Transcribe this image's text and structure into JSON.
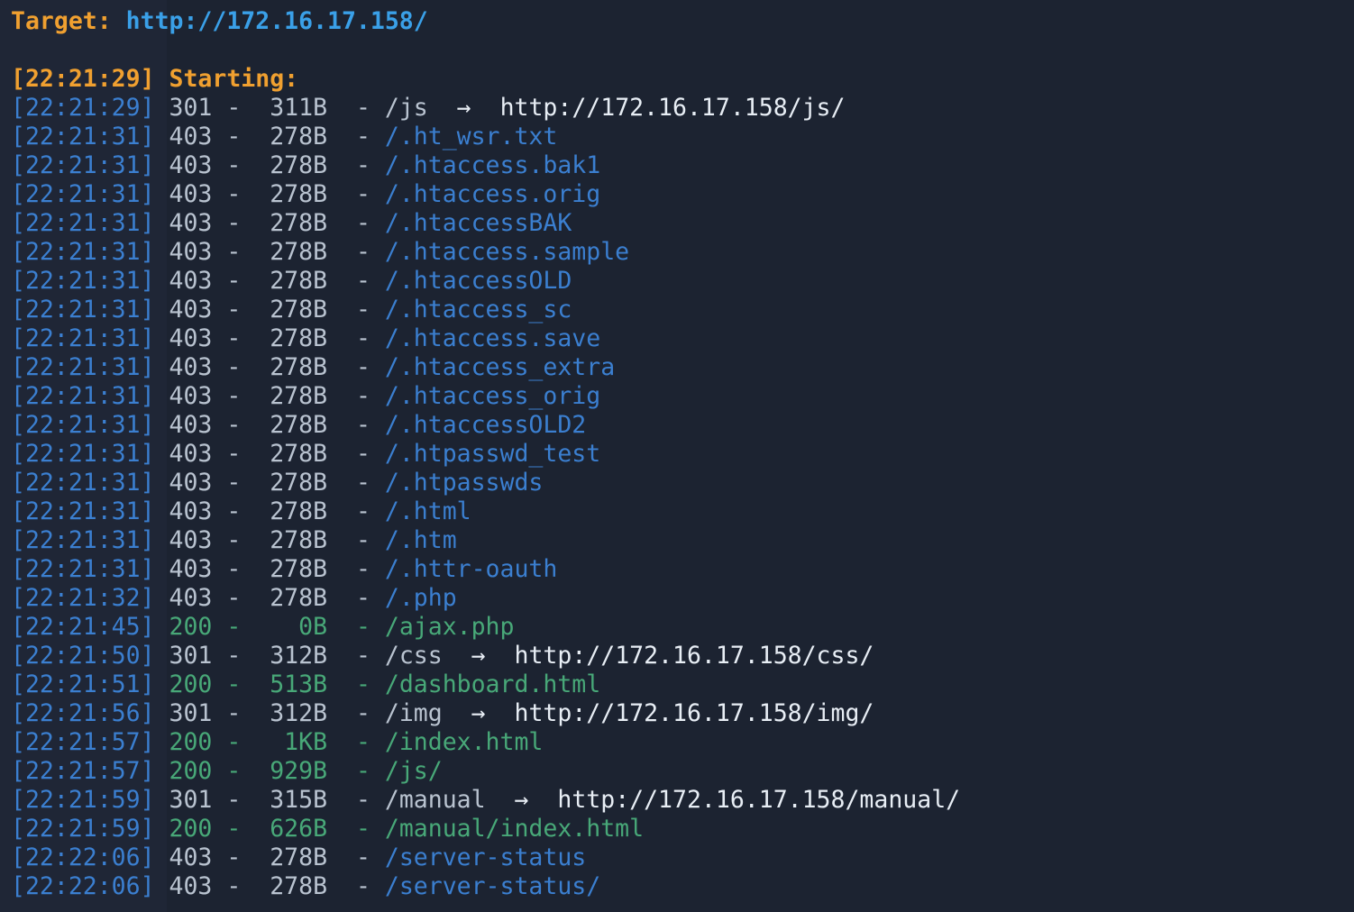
{
  "header": {
    "target_label": "Target:",
    "target_url": "http://172.16.17.158/"
  },
  "start": {
    "timestamp": "[22:21:29]",
    "label": "Starting:"
  },
  "rows": [
    {
      "ts": "[22:21:29]",
      "status": "301",
      "size": "311B",
      "path": "/js",
      "redirect": "http://172.16.17.158/js/"
    },
    {
      "ts": "[22:21:31]",
      "status": "403",
      "size": "278B",
      "path": "/.ht_wsr.txt",
      "redirect": ""
    },
    {
      "ts": "[22:21:31]",
      "status": "403",
      "size": "278B",
      "path": "/.htaccess.bak1",
      "redirect": ""
    },
    {
      "ts": "[22:21:31]",
      "status": "403",
      "size": "278B",
      "path": "/.htaccess.orig",
      "redirect": ""
    },
    {
      "ts": "[22:21:31]",
      "status": "403",
      "size": "278B",
      "path": "/.htaccessBAK",
      "redirect": ""
    },
    {
      "ts": "[22:21:31]",
      "status": "403",
      "size": "278B",
      "path": "/.htaccess.sample",
      "redirect": ""
    },
    {
      "ts": "[22:21:31]",
      "status": "403",
      "size": "278B",
      "path": "/.htaccessOLD",
      "redirect": ""
    },
    {
      "ts": "[22:21:31]",
      "status": "403",
      "size": "278B",
      "path": "/.htaccess_sc",
      "redirect": ""
    },
    {
      "ts": "[22:21:31]",
      "status": "403",
      "size": "278B",
      "path": "/.htaccess.save",
      "redirect": ""
    },
    {
      "ts": "[22:21:31]",
      "status": "403",
      "size": "278B",
      "path": "/.htaccess_extra",
      "redirect": ""
    },
    {
      "ts": "[22:21:31]",
      "status": "403",
      "size": "278B",
      "path": "/.htaccess_orig",
      "redirect": ""
    },
    {
      "ts": "[22:21:31]",
      "status": "403",
      "size": "278B",
      "path": "/.htaccessOLD2",
      "redirect": ""
    },
    {
      "ts": "[22:21:31]",
      "status": "403",
      "size": "278B",
      "path": "/.htpasswd_test",
      "redirect": ""
    },
    {
      "ts": "[22:21:31]",
      "status": "403",
      "size": "278B",
      "path": "/.htpasswds",
      "redirect": ""
    },
    {
      "ts": "[22:21:31]",
      "status": "403",
      "size": "278B",
      "path": "/.html",
      "redirect": ""
    },
    {
      "ts": "[22:21:31]",
      "status": "403",
      "size": "278B",
      "path": "/.htm",
      "redirect": ""
    },
    {
      "ts": "[22:21:31]",
      "status": "403",
      "size": "278B",
      "path": "/.httr-oauth",
      "redirect": ""
    },
    {
      "ts": "[22:21:32]",
      "status": "403",
      "size": "278B",
      "path": "/.php",
      "redirect": ""
    },
    {
      "ts": "[22:21:45]",
      "status": "200",
      "size": "0B",
      "path": "/ajax.php",
      "redirect": ""
    },
    {
      "ts": "[22:21:50]",
      "status": "301",
      "size": "312B",
      "path": "/css",
      "redirect": "http://172.16.17.158/css/"
    },
    {
      "ts": "[22:21:51]",
      "status": "200",
      "size": "513B",
      "path": "/dashboard.html",
      "redirect": ""
    },
    {
      "ts": "[22:21:56]",
      "status": "301",
      "size": "312B",
      "path": "/img",
      "redirect": "http://172.16.17.158/img/"
    },
    {
      "ts": "[22:21:57]",
      "status": "200",
      "size": "1KB",
      "path": "/index.html",
      "redirect": ""
    },
    {
      "ts": "[22:21:57]",
      "status": "200",
      "size": "929B",
      "path": "/js/",
      "redirect": ""
    },
    {
      "ts": "[22:21:59]",
      "status": "301",
      "size": "315B",
      "path": "/manual",
      "redirect": "http://172.16.17.158/manual/"
    },
    {
      "ts": "[22:21:59]",
      "status": "200",
      "size": "626B",
      "path": "/manual/index.html",
      "redirect": ""
    },
    {
      "ts": "[22:22:06]",
      "status": "403",
      "size": "278B",
      "path": "/server-status",
      "redirect": ""
    },
    {
      "ts": "[22:22:06]",
      "status": "403",
      "size": "278B",
      "path": "/server-status/",
      "redirect": ""
    }
  ],
  "separator": " - ",
  "arrow": "→",
  "colors": {
    "background": "#1c2331",
    "accent_orange": "#f0a030",
    "url_blue": "#3aa0e8",
    "timestamp_blue": "#3b7fd0",
    "status_200_green": "#48a878",
    "text_light": "#b9c3d0"
  }
}
